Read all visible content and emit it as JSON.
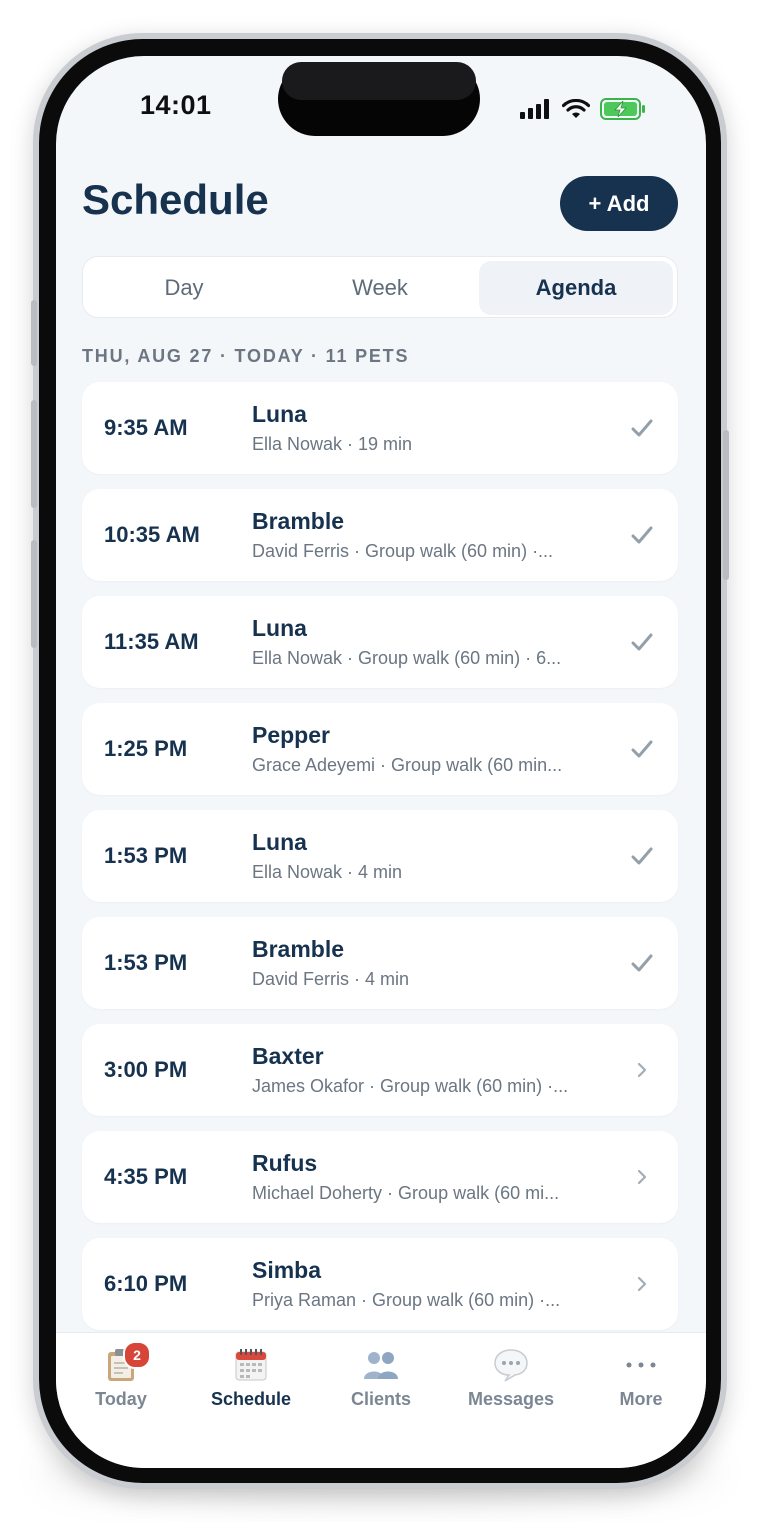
{
  "status_bar": {
    "time": "14:01"
  },
  "header": {
    "title": "Schedule",
    "add_label": "+ Add"
  },
  "view_tabs": [
    {
      "label": "Day",
      "active": false
    },
    {
      "label": "Week",
      "active": false
    },
    {
      "label": "Agenda",
      "active": true
    }
  ],
  "section": {
    "header": "THU, AUG 27 · TODAY · 11 PETS"
  },
  "appointments": [
    {
      "time": "9:35 AM",
      "pet": "Luna",
      "detail": "Ella Nowak · 19 min",
      "status": "done"
    },
    {
      "time": "10:35 AM",
      "pet": "Bramble",
      "detail": "David Ferris · Group walk (60 min) ·...",
      "status": "done"
    },
    {
      "time": "11:35 AM",
      "pet": "Luna",
      "detail": "Ella Nowak · Group walk (60 min) · 6...",
      "status": "done"
    },
    {
      "time": "1:25 PM",
      "pet": "Pepper",
      "detail": "Grace Adeyemi · Group walk (60 min...",
      "status": "done"
    },
    {
      "time": "1:53 PM",
      "pet": "Luna",
      "detail": "Ella Nowak · 4 min",
      "status": "done"
    },
    {
      "time": "1:53 PM",
      "pet": "Bramble",
      "detail": "David Ferris · 4 min",
      "status": "done"
    },
    {
      "time": "3:00 PM",
      "pet": "Baxter",
      "detail": "James Okafor · Group walk (60 min) ·...",
      "status": "upcoming"
    },
    {
      "time": "4:35 PM",
      "pet": "Rufus",
      "detail": "Michael Doherty · Group walk (60 mi...",
      "status": "upcoming"
    },
    {
      "time": "6:10 PM",
      "pet": "Simba",
      "detail": "Priya Raman · Group walk (60 min) ·...",
      "status": "upcoming"
    }
  ],
  "tab_bar": [
    {
      "label": "Today",
      "icon": "clipboard-icon",
      "badge": "2",
      "active": false
    },
    {
      "label": "Schedule",
      "icon": "calendar-icon",
      "active": true
    },
    {
      "label": "Clients",
      "icon": "people-icon",
      "active": false
    },
    {
      "label": "Messages",
      "icon": "speech-bubble-icon",
      "active": false
    },
    {
      "label": "More",
      "icon": "more-icon",
      "active": false
    }
  ],
  "colors": {
    "primary": "#16324f",
    "muted_text": "#6b7682",
    "background": "#f4f7fa",
    "check": "#93a0ab",
    "badge": "#d64538"
  }
}
